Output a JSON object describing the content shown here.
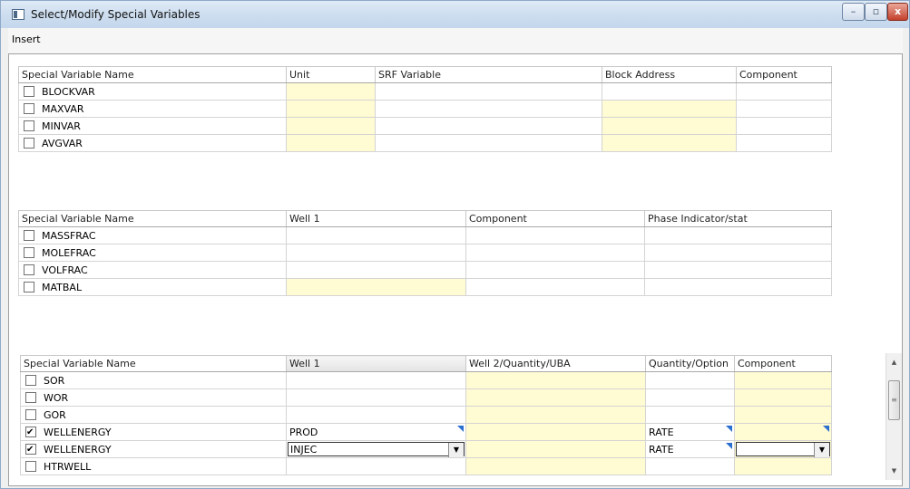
{
  "window": {
    "title": "Select/Modify Special Variables",
    "minimize_label": "–",
    "maximize_label": "▫",
    "close_label": "x"
  },
  "menu": {
    "insert_label": "Insert"
  },
  "grid1": {
    "headers": [
      "Special Variable Name",
      "Unit",
      "SRF Variable",
      "Block Address",
      "Component"
    ],
    "rows": [
      {
        "checked": false,
        "name": "BLOCKVAR",
        "unit": "",
        "srf": "",
        "block": "",
        "component": ""
      },
      {
        "checked": false,
        "name": "MAXVAR",
        "unit": "",
        "srf": "",
        "block": "",
        "component": ""
      },
      {
        "checked": false,
        "name": "MINVAR",
        "unit": "",
        "srf": "",
        "block": "",
        "component": ""
      },
      {
        "checked": false,
        "name": "AVGVAR",
        "unit": "",
        "srf": "",
        "block": "",
        "component": ""
      }
    ]
  },
  "grid2": {
    "headers": [
      "Special Variable Name",
      "Well 1",
      "Component",
      "Phase Indicator/stat"
    ],
    "rows": [
      {
        "checked": false,
        "name": "MASSFRAC"
      },
      {
        "checked": false,
        "name": "MOLEFRAC"
      },
      {
        "checked": false,
        "name": "VOLFRAC"
      },
      {
        "checked": false,
        "name": "MATBAL"
      }
    ]
  },
  "grid3": {
    "headers": [
      "Special Variable Name",
      "Well 1",
      "Well 2/Quantity/UBA",
      "Quantity/Option",
      "Component"
    ],
    "rows": [
      {
        "checked": false,
        "name": "SOR",
        "well1": "",
        "well2": "",
        "qty": "",
        "component": ""
      },
      {
        "checked": false,
        "name": "WOR",
        "well1": "",
        "well2": "",
        "qty": "",
        "component": ""
      },
      {
        "checked": false,
        "name": "GOR",
        "well1": "",
        "well2": "",
        "qty": "",
        "component": ""
      },
      {
        "checked": true,
        "name": "WELLENERGY",
        "well1": "PROD",
        "well2": "",
        "qty": "RATE",
        "component": ""
      },
      {
        "checked": true,
        "name": "WELLENERGY",
        "well1": "INJEC",
        "well2": "",
        "qty": "RATE",
        "component": ""
      },
      {
        "checked": false,
        "name": "HTRWELL",
        "well1": "",
        "well2": "",
        "qty": "",
        "component": ""
      }
    ]
  },
  "scrollbar": {
    "up_label": "▲",
    "down_label": "▼",
    "thumb_grip": "≡"
  },
  "colors": {
    "cell_highlight": "#fffbd2",
    "titlebar": "#cfdff0",
    "corner_marker": "#2a6fd0"
  }
}
